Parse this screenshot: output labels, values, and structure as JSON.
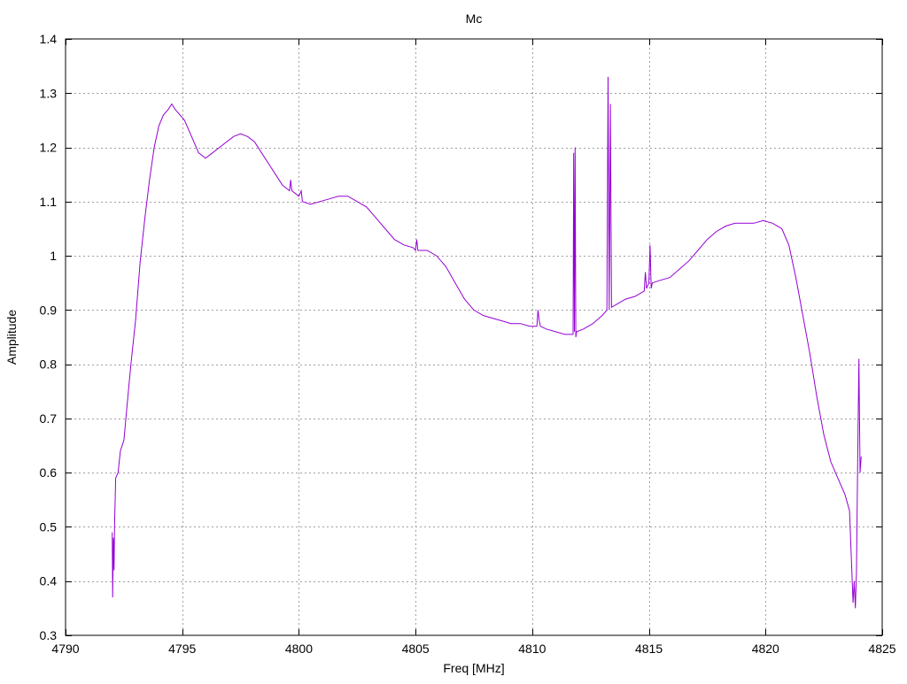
{
  "chart_data": {
    "type": "line",
    "title": "Mc",
    "xlabel": "Freq [MHz]",
    "ylabel": "Amplitude",
    "xlim": [
      4790,
      4825
    ],
    "ylim": [
      0.3,
      1.4
    ],
    "x_ticks": [
      4790,
      4795,
      4800,
      4805,
      4810,
      4815,
      4820,
      4825
    ],
    "x_tick_labels": [
      "4790",
      "4795",
      "4800",
      "4805",
      "4810",
      "4815",
      "4820",
      "4825"
    ],
    "y_ticks": [
      0.3,
      0.4,
      0.5,
      0.6,
      0.7,
      0.8,
      0.9,
      1.0,
      1.1,
      1.2,
      1.3,
      1.4
    ],
    "y_tick_labels": [
      "0.3",
      "0.4",
      "0.5",
      "0.6",
      "0.7",
      "0.8",
      "0.9",
      "1",
      "1.1",
      "1.2",
      "1.3",
      "1.4"
    ],
    "grid": true,
    "legend": "none",
    "series": [
      {
        "color": "#9400d3",
        "x": [
          4792.0,
          4792.02,
          4792.05,
          4792.08,
          4792.1,
          4792.15,
          4792.25,
          4792.35,
          4792.5,
          4792.65,
          4792.8,
          4793.0,
          4793.2,
          4793.4,
          4793.6,
          4793.8,
          4794.0,
          4794.2,
          4794.4,
          4794.55,
          4794.7,
          4794.9,
          4795.1,
          4795.4,
          4795.7,
          4796.0,
          4796.3,
          4796.6,
          4796.9,
          4797.2,
          4797.5,
          4797.8,
          4798.1,
          4798.4,
          4798.7,
          4799.0,
          4799.3,
          4799.6,
          4799.65,
          4799.7,
          4800.0,
          4800.1,
          4800.15,
          4800.5,
          4800.9,
          4801.3,
          4801.7,
          4802.1,
          4802.5,
          4802.9,
          4803.3,
          4803.7,
          4804.1,
          4804.5,
          4804.9,
          4805.0,
          4805.05,
          4805.1,
          4805.5,
          4805.9,
          4806.3,
          4806.7,
          4807.1,
          4807.5,
          4807.9,
          4808.3,
          4808.7,
          4809.1,
          4809.5,
          4809.9,
          4810.2,
          4810.25,
          4810.3,
          4810.35,
          4810.6,
          4811.0,
          4811.4,
          4811.75,
          4811.78,
          4811.81,
          4811.84,
          4811.87,
          4811.9,
          4812.2,
          4812.6,
          4813.0,
          4813.2,
          4813.25,
          4813.3,
          4813.35,
          4813.4,
          4813.6,
          4814.0,
          4814.4,
          4814.8,
          4814.85,
          4814.9,
          4815.0,
          4815.05,
          4815.1,
          4815.15,
          4815.5,
          4815.9,
          4816.3,
          4816.7,
          4817.1,
          4817.5,
          4817.9,
          4818.3,
          4818.7,
          4819.1,
          4819.5,
          4819.9,
          4820.3,
          4820.7,
          4821.0,
          4821.3,
          4821.6,
          4821.9,
          4822.2,
          4822.5,
          4822.8,
          4823.1,
          4823.4,
          4823.6,
          4823.75,
          4823.8,
          4823.85,
          4823.9,
          4823.95,
          4824.0,
          4824.05,
          4824.1
        ],
        "y": [
          0.49,
          0.37,
          0.48,
          0.42,
          0.5,
          0.59,
          0.6,
          0.64,
          0.66,
          0.73,
          0.8,
          0.88,
          0.99,
          1.07,
          1.14,
          1.2,
          1.24,
          1.26,
          1.27,
          1.28,
          1.27,
          1.26,
          1.25,
          1.22,
          1.19,
          1.18,
          1.19,
          1.2,
          1.21,
          1.22,
          1.225,
          1.22,
          1.21,
          1.19,
          1.17,
          1.15,
          1.13,
          1.12,
          1.14,
          1.12,
          1.11,
          1.12,
          1.1,
          1.095,
          1.1,
          1.105,
          1.11,
          1.11,
          1.1,
          1.09,
          1.07,
          1.05,
          1.03,
          1.02,
          1.015,
          1.01,
          1.03,
          1.01,
          1.01,
          1.0,
          0.98,
          0.95,
          0.92,
          0.9,
          0.89,
          0.885,
          0.88,
          0.875,
          0.875,
          0.87,
          0.87,
          0.9,
          0.88,
          0.87,
          0.865,
          0.86,
          0.855,
          0.855,
          1.19,
          0.86,
          1.2,
          0.85,
          0.86,
          0.865,
          0.875,
          0.89,
          0.9,
          1.33,
          0.9,
          1.28,
          0.905,
          0.91,
          0.92,
          0.925,
          0.935,
          0.97,
          0.94,
          0.95,
          1.02,
          0.94,
          0.95,
          0.955,
          0.96,
          0.975,
          0.99,
          1.01,
          1.03,
          1.045,
          1.055,
          1.06,
          1.06,
          1.06,
          1.065,
          1.06,
          1.05,
          1.02,
          0.96,
          0.89,
          0.82,
          0.74,
          0.67,
          0.62,
          0.59,
          0.56,
          0.53,
          0.36,
          0.4,
          0.35,
          0.42,
          0.62,
          0.81,
          0.6,
          0.63
        ]
      }
    ]
  }
}
